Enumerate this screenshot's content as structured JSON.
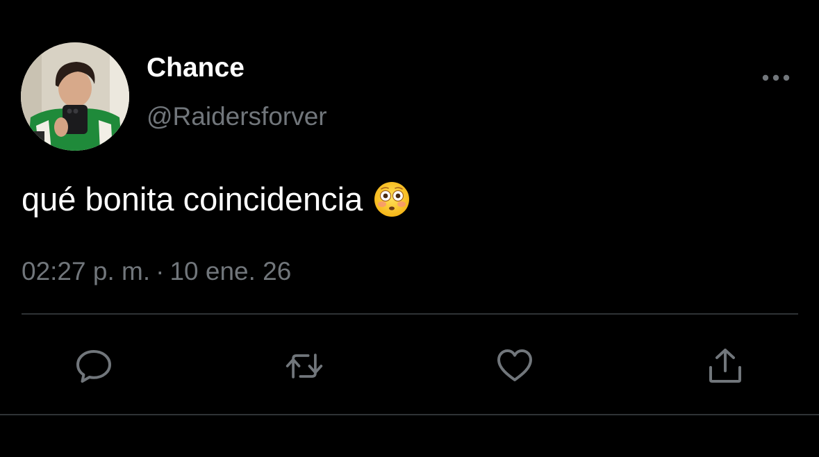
{
  "author": {
    "display_name": "Chance",
    "handle": "@Raidersforver",
    "avatar": "profile-photo"
  },
  "tweet": {
    "text": "qué bonita coincidencia",
    "emoji": "flushed-face-emoji",
    "time": "02:27 p. m.",
    "separator": "·",
    "date": "10 ene. 26"
  },
  "actions": [
    {
      "name": "reply",
      "icon": "speech-bubble-icon"
    },
    {
      "name": "retweet",
      "icon": "retweet-icon"
    },
    {
      "name": "like",
      "icon": "heart-icon"
    },
    {
      "name": "share",
      "icon": "share-icon"
    }
  ],
  "colors": {
    "background": "#000000",
    "primary_text": "#ffffff",
    "secondary_text": "#71767b",
    "divider": "#2f3336",
    "icon": "#71767b"
  }
}
